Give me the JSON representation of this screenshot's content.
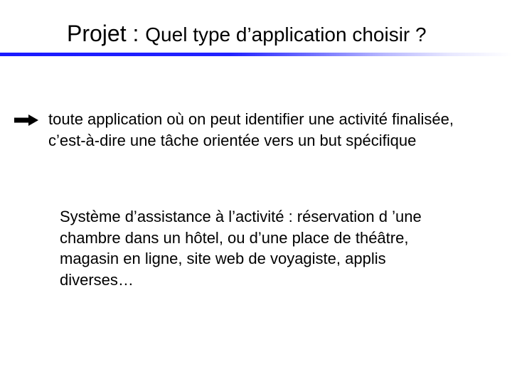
{
  "title": {
    "lead": "Projet : ",
    "rest": "Quel type d’application choisir ?"
  },
  "bullet": "toute application où on peut identifier une activité finalisée, c’est-à-dire une tâche orientée vers un but spécifique",
  "paragraph": "Système d’assistance à l’activité : réservation d ’une chambre dans un hôtel, ou d’une place de théâtre, magasin en ligne, site web de voyagiste, applis diverses…",
  "icons": {
    "arrow": "arrow-right-icon"
  }
}
